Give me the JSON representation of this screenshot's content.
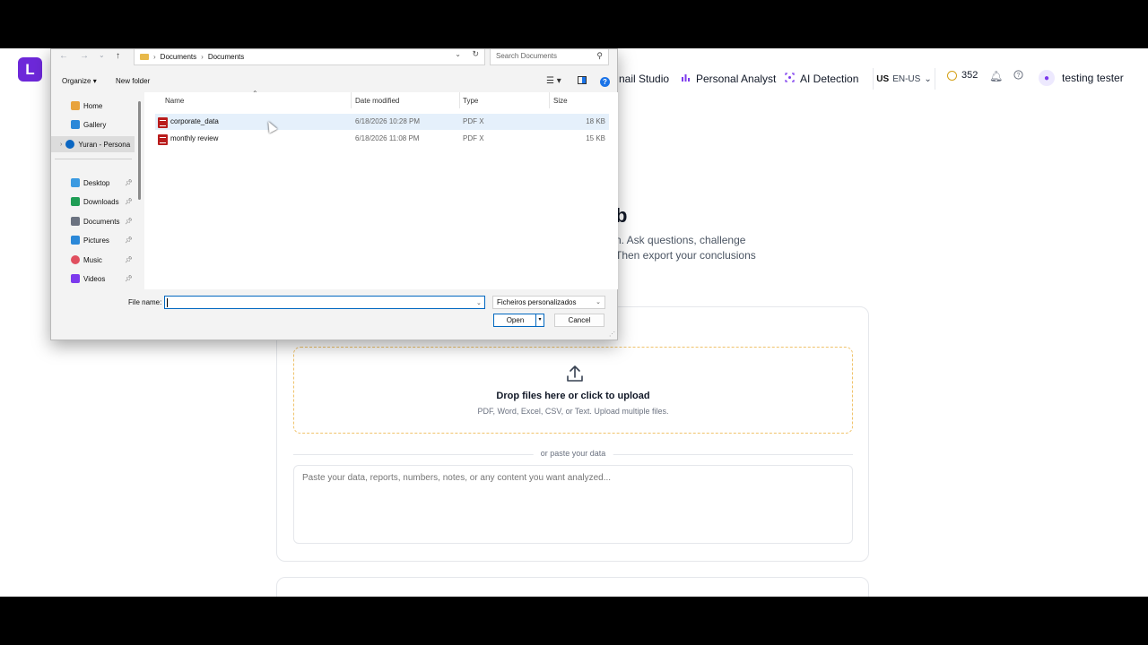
{
  "app": {
    "logo_letter": "L",
    "nav": [
      {
        "label": "nail Studio",
        "icon": ""
      },
      {
        "label": "Personal Analyst",
        "icon": "bar-chart-icon"
      },
      {
        "label": "AI Detection",
        "icon": "scan-icon"
      }
    ],
    "lang_flag": "US",
    "lang_code": "EN-US",
    "credits": "352",
    "user_name": "testing tester",
    "hero_title": "b",
    "hero_sub_1": "n. Ask questions, challenge",
    "hero_sub_2": "Then export your conclusions",
    "upload_title": "Drop files here or click to upload",
    "upload_sub": "PDF, Word, Excel, CSV, or Text. Upload multiple files.",
    "or_text": "or paste your data",
    "paste_placeholder": "Paste your data, reports, numbers, notes, or any content you want analyzed..."
  },
  "dialog": {
    "breadcrumb": [
      "Documents",
      "Documents"
    ],
    "search_placeholder": "Search Documents",
    "organize": "Organize",
    "new_folder": "New folder",
    "nav_items": [
      {
        "label": "Home",
        "icon": "home-icon",
        "color": "#e8a33d"
      },
      {
        "label": "Gallery",
        "icon": "gallery-icon",
        "color": "#2b88d8"
      },
      {
        "label": "Yuran - Persona",
        "icon": "onedrive-icon",
        "color": "#0a66c2"
      },
      {
        "label": "Desktop",
        "icon": "desktop-icon",
        "color": "#3b9ae1"
      },
      {
        "label": "Downloads",
        "icon": "download-icon",
        "color": "#1f9d55"
      },
      {
        "label": "Documents",
        "icon": "documents-icon",
        "color": "#6b7280"
      },
      {
        "label": "Pictures",
        "icon": "pictures-icon",
        "color": "#2b88d8"
      },
      {
        "label": "Music",
        "icon": "music-icon",
        "color": "#e04f5f"
      },
      {
        "label": "Videos",
        "icon": "videos-icon",
        "color": "#7c3aed"
      }
    ],
    "columns": {
      "name": "Name",
      "date": "Date modified",
      "type": "Type",
      "size": "Size"
    },
    "files": [
      {
        "name": "corporate_data",
        "date": "6/18/2026 10:28 PM",
        "type": "PDF X",
        "size": "18 KB"
      },
      {
        "name": "monthly review",
        "date": "6/18/2026 11:08 PM",
        "type": "PDF X",
        "size": "15 KB"
      }
    ],
    "file_name_label": "File name:",
    "file_name_value": "",
    "file_type": "Ficheiros personalizados",
    "open": "Open",
    "cancel": "Cancel"
  }
}
